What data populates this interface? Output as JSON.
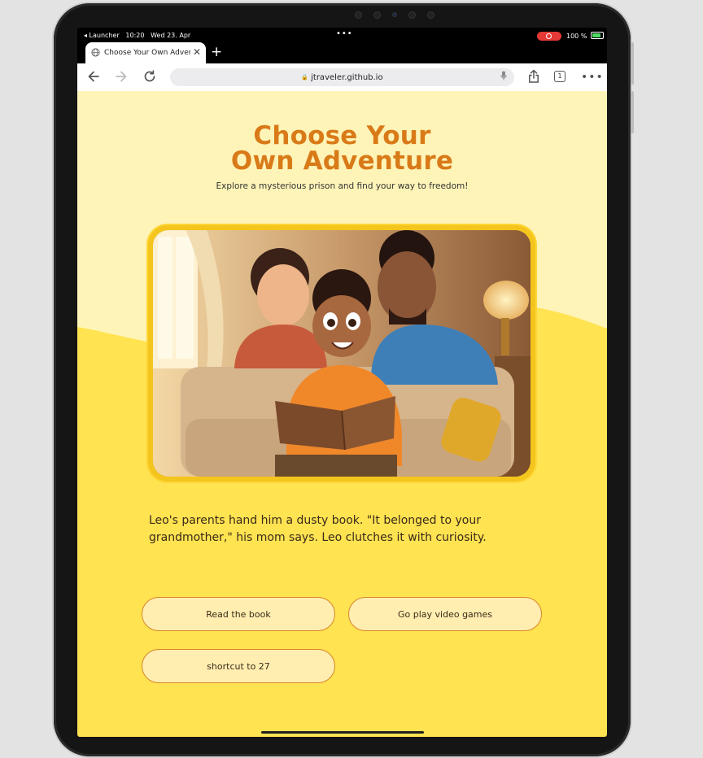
{
  "status_bar": {
    "back_app": "◂ Launcher",
    "time": "10:20",
    "date": "Wed 23. Apr",
    "battery": "100 %"
  },
  "browser": {
    "tab_title": "Choose Your Own Adventure",
    "url": "jtraveler.github.io",
    "tab_count": "1"
  },
  "page": {
    "title": "Choose Your Own Adventure",
    "subtitle": "Explore a mysterious prison and find your way to freedom!",
    "story": "Leo's parents hand him a dusty book. \"It belonged to your grandmother,\" his mom says. Leo clutches it with curiosity.",
    "choices": [
      {
        "label": "Read the book"
      },
      {
        "label": "Go play video games"
      },
      {
        "label": "shortcut to 27"
      }
    ]
  },
  "colors": {
    "page_bg": "#ffe351",
    "page_top": "#fff4b8",
    "title": "#d97a18",
    "button_bg": "#ffeeb0",
    "button_border": "#d8842a",
    "frame": "#f4c51d"
  }
}
